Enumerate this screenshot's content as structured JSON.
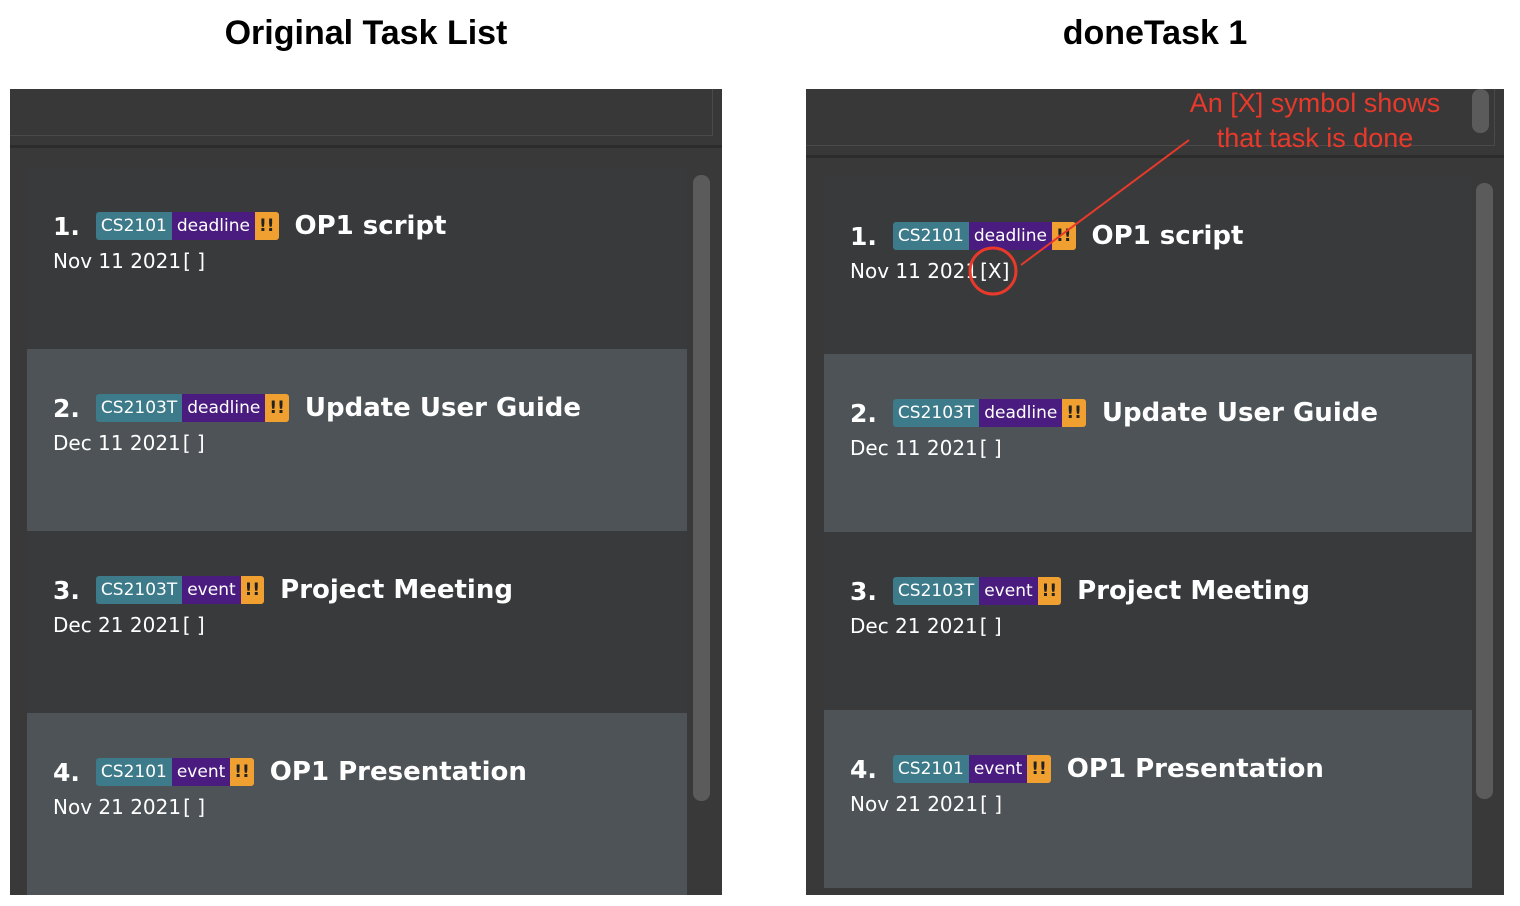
{
  "left_panel": {
    "heading": "Original Task List",
    "tasks": [
      {
        "index": "1.",
        "module": "CS2101",
        "type": "deadline",
        "priority": "!!",
        "title": "OP1 script",
        "date": "Nov 11 2021",
        "status": "[ ]"
      },
      {
        "index": "2.",
        "module": "CS2103T",
        "type": "deadline",
        "priority": "!!",
        "title": "Update User Guide",
        "date": "Dec 11 2021",
        "status": "[ ]"
      },
      {
        "index": "3.",
        "module": "CS2103T",
        "type": "event",
        "priority": "!!",
        "title": "Project Meeting",
        "date": "Dec 21 2021",
        "status": "[ ]"
      },
      {
        "index": "4.",
        "module": "CS2101",
        "type": "event",
        "priority": "!!",
        "title": "OP1 Presentation",
        "date": "Nov 21 2021",
        "status": "[ ]"
      }
    ]
  },
  "right_panel": {
    "heading": "doneTask 1",
    "tasks": [
      {
        "index": "1.",
        "module": "CS2101",
        "type": "deadline",
        "priority": "!!",
        "title": "OP1 script",
        "date": "Nov 11 2021",
        "status": "[X]"
      },
      {
        "index": "2.",
        "module": "CS2103T",
        "type": "deadline",
        "priority": "!!",
        "title": "Update User Guide",
        "date": "Dec 11 2021",
        "status": "[ ]"
      },
      {
        "index": "3.",
        "module": "CS2103T",
        "type": "event",
        "priority": "!!",
        "title": "Project Meeting",
        "date": "Dec 21 2021",
        "status": "[ ]"
      },
      {
        "index": "4.",
        "module": "CS2101",
        "type": "event",
        "priority": "!!",
        "title": "OP1 Presentation",
        "date": "Nov 21 2021",
        "status": "[ ]"
      }
    ]
  },
  "annotation": {
    "line1": "An [X] symbol shows",
    "line2": "that task is done",
    "color": "#e8392a"
  },
  "colors": {
    "module_tag": "#3d7a8a",
    "type_tag": "#4b1c80",
    "priority_tag": "#f0a030",
    "card_dark": "#393a3c",
    "card_light": "#4d5356"
  }
}
